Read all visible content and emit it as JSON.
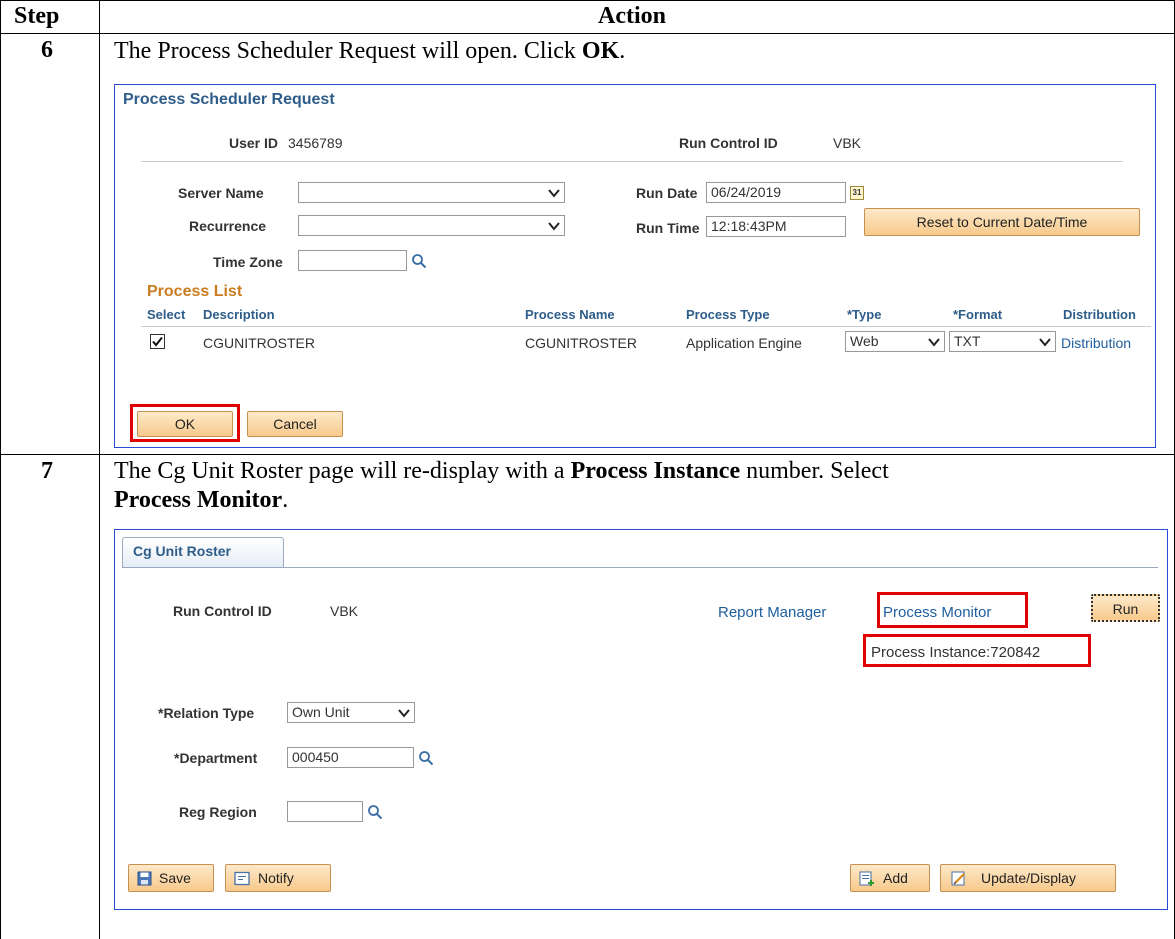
{
  "table": {
    "header": {
      "step": "Step",
      "action": "Action"
    }
  },
  "step6": {
    "number": "6",
    "instruction_prefix": "The Process Scheduler Request will open.  Click ",
    "instruction_bold": "OK",
    "instruction_suffix": ".",
    "dialog": {
      "title": "Process Scheduler Request",
      "user_id_label": "User ID",
      "user_id_value": "3456789",
      "run_control_label": "Run Control ID",
      "run_control_value": "VBK",
      "server_name_label": "Server Name",
      "server_name_value": "",
      "recurrence_label": "Recurrence",
      "recurrence_value": "",
      "time_zone_label": "Time Zone",
      "time_zone_value": "",
      "run_date_label": "Run Date",
      "run_date_value": "06/24/2019",
      "run_time_label": "Run Time",
      "run_time_value": "12:18:43PM",
      "calendar_icon_text": "31",
      "reset_button": "Reset to Current Date/Time",
      "process_list": {
        "title": "Process List",
        "columns": [
          "Select",
          "Description",
          "Process Name",
          "Process Type",
          "*Type",
          "*Format",
          "Distribution"
        ],
        "row": {
          "checked": true,
          "description": "CGUNITROSTER",
          "process_name": "CGUNITROSTER",
          "process_type": "Application Engine",
          "type": "Web",
          "format": "TXT",
          "distribution": "Distribution"
        }
      },
      "ok_button": "OK",
      "cancel_button": "Cancel"
    }
  },
  "step7": {
    "number": "7",
    "instruction_line1_prefix": "The Cg Unit Roster page will re-display with a ",
    "instruction_line1_bold": "Process Instance",
    "instruction_line1_suffix": " number.  Select",
    "instruction_line2_bold": "Process Monitor",
    "instruction_line2_suffix": ".",
    "page": {
      "tab_label": "Cg Unit Roster",
      "run_control_label": "Run Control ID",
      "run_control_value": "VBK",
      "report_manager_link": "Report Manager",
      "process_monitor_link": "Process Monitor",
      "run_button": "Run",
      "process_instance_text": "Process Instance:720842",
      "relation_type_label": "*Relation Type",
      "relation_type_value": "Own Unit",
      "department_label": "*Department",
      "department_value": "000450",
      "reg_region_label": "Reg Region",
      "reg_region_value": "",
      "save_button": "Save",
      "notify_button": "Notify",
      "add_button": "Add",
      "update_display_button": "Update/Display"
    }
  }
}
